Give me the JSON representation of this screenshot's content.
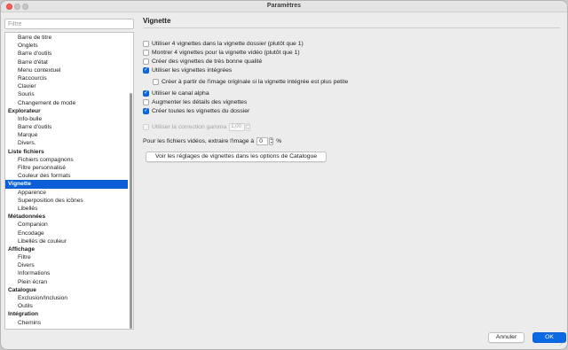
{
  "window": {
    "title": "Paramètres"
  },
  "sidebar": {
    "filter_placeholder": "Filtre",
    "items": [
      {
        "label": "Barre de titre",
        "level": "sub",
        "selected": false
      },
      {
        "label": "Onglets",
        "level": "sub",
        "selected": false
      },
      {
        "label": "Barre d'outils",
        "level": "sub",
        "selected": false
      },
      {
        "label": "Barre d'état",
        "level": "sub",
        "selected": false
      },
      {
        "label": "Menu contextuel",
        "level": "sub",
        "selected": false
      },
      {
        "label": "Raccourcis",
        "level": "sub",
        "selected": false
      },
      {
        "label": "Clavier",
        "level": "sub",
        "selected": false
      },
      {
        "label": "Souris",
        "level": "sub",
        "selected": false
      },
      {
        "label": "Changement de mode",
        "level": "sub",
        "selected": false
      },
      {
        "label": "Explorateur",
        "level": "cat",
        "selected": false
      },
      {
        "label": "Info-bulle",
        "level": "sub",
        "selected": false
      },
      {
        "label": "Barre d'outils",
        "level": "sub",
        "selected": false
      },
      {
        "label": "Marque",
        "level": "sub",
        "selected": false
      },
      {
        "label": "Divers.",
        "level": "sub",
        "selected": false
      },
      {
        "label": "Liste fichiers",
        "level": "cat",
        "selected": false
      },
      {
        "label": "Fichiers compagnons",
        "level": "sub",
        "selected": false
      },
      {
        "label": "Filtre personnalisé",
        "level": "sub",
        "selected": false
      },
      {
        "label": "Couleur des formats",
        "level": "sub",
        "selected": false
      },
      {
        "label": "Vignette",
        "level": "cat",
        "selected": true
      },
      {
        "label": "Apparence",
        "level": "sub",
        "selected": false
      },
      {
        "label": "Superposition des icônes",
        "level": "sub",
        "selected": false
      },
      {
        "label": "Libellés",
        "level": "sub",
        "selected": false
      },
      {
        "label": "Métadonnées",
        "level": "cat",
        "selected": false
      },
      {
        "label": "Companion",
        "level": "sub",
        "selected": false
      },
      {
        "label": "Encodage",
        "level": "sub",
        "selected": false
      },
      {
        "label": "Libellés de couleur",
        "level": "sub",
        "selected": false
      },
      {
        "label": "Affichage",
        "level": "cat",
        "selected": false
      },
      {
        "label": "Filtre",
        "level": "sub",
        "selected": false
      },
      {
        "label": "Divers",
        "level": "sub",
        "selected": false
      },
      {
        "label": "Informations",
        "level": "sub",
        "selected": false
      },
      {
        "label": "Plein écran",
        "level": "sub",
        "selected": false
      },
      {
        "label": "Catalogue",
        "level": "cat",
        "selected": false
      },
      {
        "label": "Exclusion/Inclusion",
        "level": "sub",
        "selected": false
      },
      {
        "label": "Outils",
        "level": "sub",
        "selected": false
      },
      {
        "label": "Intégration",
        "level": "cat",
        "selected": false
      },
      {
        "label": "Chemins",
        "level": "sub",
        "selected": false
      }
    ]
  },
  "panel": {
    "heading": "Vignette",
    "options": [
      {
        "label": "Utiliser 4 vignettes dans la vignette dossier (plutôt que 1)",
        "checked": false,
        "enabled": true,
        "indent": false
      },
      {
        "label": "Montrer 4 vignettes pour la vignette vidéo (plutôt que 1)",
        "checked": false,
        "enabled": true,
        "indent": false
      },
      {
        "label": "Créer des vignettes de très bonne qualité",
        "checked": false,
        "enabled": true,
        "indent": false
      },
      {
        "label": "Utiliser les vignettes intégrées",
        "checked": true,
        "enabled": true,
        "indent": false
      },
      {
        "label": "Créer à partir de l'image originale si la vignette intégrée est plus petite",
        "checked": false,
        "enabled": true,
        "indent": true
      },
      {
        "label": "Utiliser le canal alpha",
        "checked": true,
        "enabled": true,
        "indent": false
      },
      {
        "label": "Augmenter les détails des vignettes",
        "checked": false,
        "enabled": true,
        "indent": false
      },
      {
        "label": "Créer toutes les vignettes du dossier",
        "checked": true,
        "enabled": true,
        "indent": false
      }
    ],
    "gamma": {
      "label": "Utiliser la correction gamma",
      "checked": false,
      "enabled": false,
      "value": "1,00"
    },
    "video": {
      "label": "Pour les fichiers vidéos, extraire l'image à",
      "value": "0",
      "unit": "%"
    },
    "catalog_button": "Voir les réglages de vignettes dans les options de Catalogue"
  },
  "footer": {
    "cancel_label": "Annuler",
    "ok_label": "OK"
  },
  "colors": {
    "accent": "#0a69e3",
    "selection": "#0a5fd6",
    "close": "#ff5f57"
  }
}
